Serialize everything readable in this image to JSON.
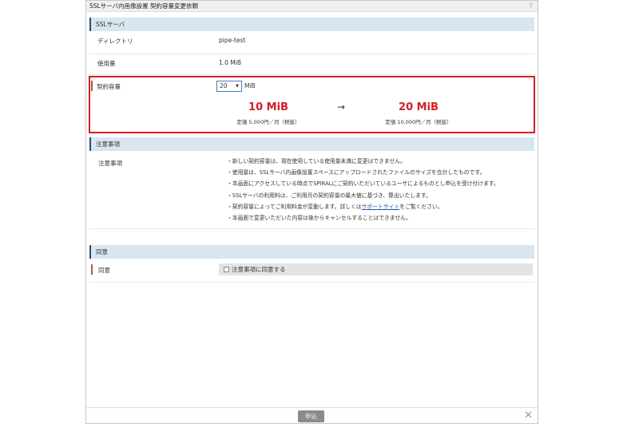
{
  "dialog": {
    "title": "SSLサーバ内画像設置 契約容量変更依頼",
    "help_icon": "?",
    "submit_label": "申込",
    "close_icon": "✕"
  },
  "ssl_section": {
    "header": "SSLサーバ",
    "directory_label": "ディレクトリ",
    "directory_value": "pipe-test",
    "usage_label": "使用量",
    "usage_value": "1.0 MiB"
  },
  "capacity": {
    "label": "契約容量",
    "selected": "20",
    "unit": "MiB",
    "current_size": "10 MiB",
    "current_price": "定価 5,000円／月（税抜）",
    "arrow": "→",
    "new_size": "20 MiB",
    "new_price": "定価 10,000円／月（税抜）"
  },
  "notes_section": {
    "header": "注意事項",
    "label": "注意事項",
    "items": [
      "・新しい契約容量は、現在使用している使用量未満に変更はできません。",
      "・使用量は、SSLサーバ内画像設置スペースにアップロードされたファイルのサイズを合計したものです。",
      "・本画面にアクセスしている時点でSPIRALにご契約いただいているユーザによるものとし申込を受け付けます。",
      "・SSLサーバの利用料は、ご利用月の契約容量の最大値に基づき、算出いたします。",
      "・本画面で変更いただいた内容は後からキャンセルすることはできません。"
    ],
    "link_item_prefix": "・契約容量によってご利用料金が変動します。詳しくは",
    "link_text": "サポートサイト",
    "link_item_suffix": "をご覧ください。"
  },
  "agree_section": {
    "header": "同意",
    "label": "同意",
    "checkbox_label": "注意事項に同意する",
    "checked": false
  },
  "colors": {
    "accent_red": "#d21f25",
    "section_bg": "#d7e6ef",
    "link": "#1b5aa8"
  }
}
